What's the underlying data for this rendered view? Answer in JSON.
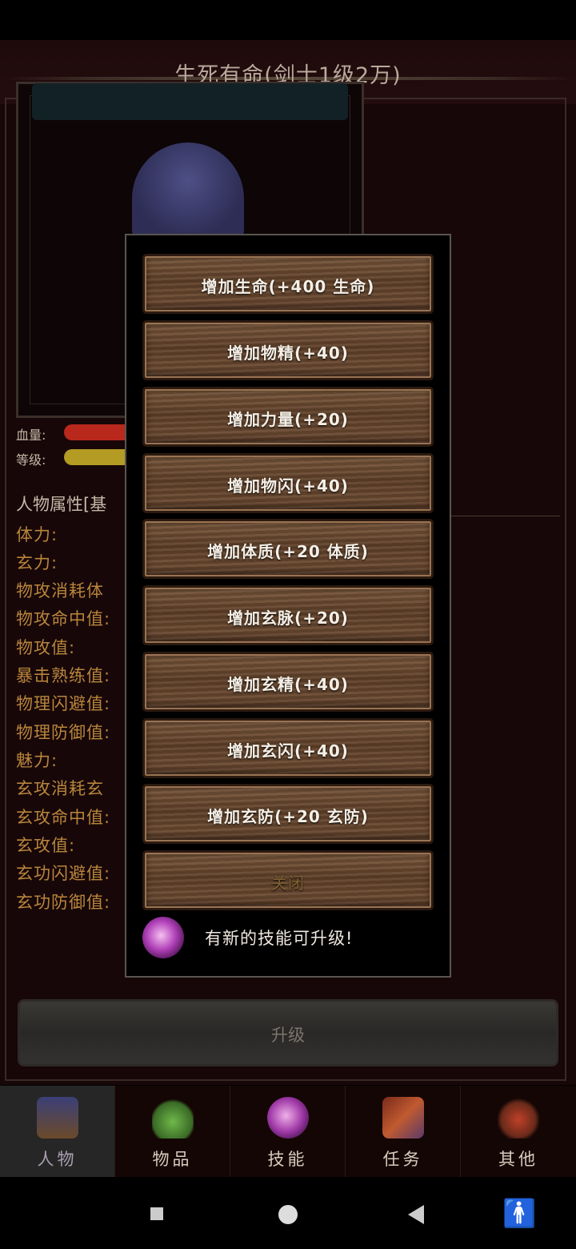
{
  "game": {
    "title": "生死有命(剑士1级2万)",
    "stats": {
      "hp_label": "血量:",
      "level_label": "等级:"
    },
    "attributes_header": "人物属性[基",
    "attributes": [
      "体力:",
      "玄力:",
      "物攻消耗体",
      "物攻命中值:",
      "物攻值:",
      "暴击熟练值:",
      "物理闪避值:",
      "物理防御值:",
      "魅力:",
      "玄攻消耗玄",
      "玄攻命中值:",
      "玄攻值:",
      "玄功闪避值:",
      "玄功防御值:"
    ],
    "upgrade_label": "升级"
  },
  "popup": {
    "buttons": [
      "增加生命(+400 生命)",
      "增加物精(+40)",
      "增加力量(+20)",
      "增加物闪(+40)",
      "增加体质(+20 体质)",
      "增加玄脉(+20)",
      "增加玄精(+40)",
      "增加玄闪(+40)",
      "增加玄防(+20 玄防)"
    ],
    "close_label": "关闭",
    "notice": "有新的技能可升级!"
  },
  "tabs": [
    {
      "label": "人物",
      "icon": "character-icon",
      "active": true
    },
    {
      "label": "物品",
      "icon": "potion-icon",
      "active": false
    },
    {
      "label": "技能",
      "icon": "skill-orb-icon",
      "active": false
    },
    {
      "label": "任务",
      "icon": "quest-icon",
      "active": false
    },
    {
      "label": "其他",
      "icon": "other-icon",
      "active": false
    }
  ],
  "colors": {
    "hp_bar": "#b8281c",
    "level_bar": "#b39b24",
    "attribute_text": "#b9853c"
  }
}
